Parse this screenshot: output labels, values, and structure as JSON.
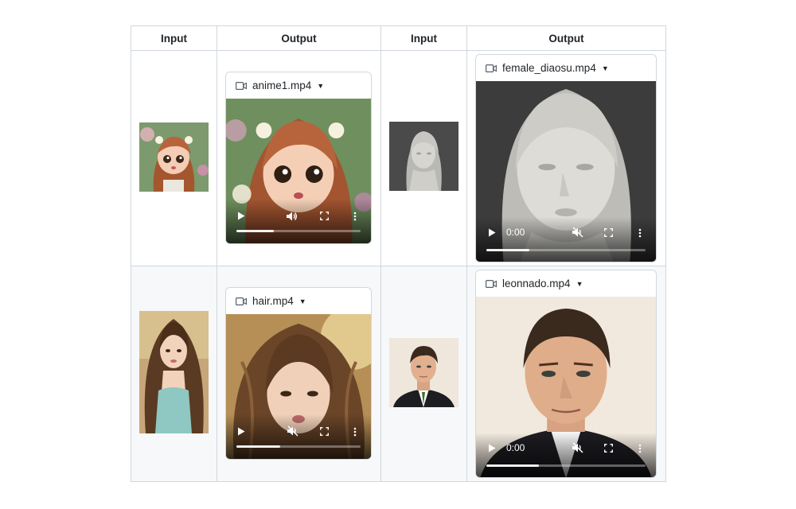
{
  "table": {
    "headers": [
      "Input",
      "Output",
      "Input",
      "Output"
    ]
  },
  "videos": [
    {
      "filename": "anime1.mp4",
      "time": "",
      "muted": false,
      "progress": 0.3
    },
    {
      "filename": "female_diaosu.mp4",
      "time": "0:00",
      "muted": true,
      "progress": 0.27
    },
    {
      "filename": "hair.mp4",
      "time": "",
      "muted": true,
      "progress": 0.35
    },
    {
      "filename": "leonnado.mp4",
      "time": "0:00",
      "muted": true,
      "progress": 0.33
    }
  ],
  "colors": {
    "border": "#d0d7de",
    "row_alt": "#f6f8fa",
    "text": "#1f2328"
  }
}
